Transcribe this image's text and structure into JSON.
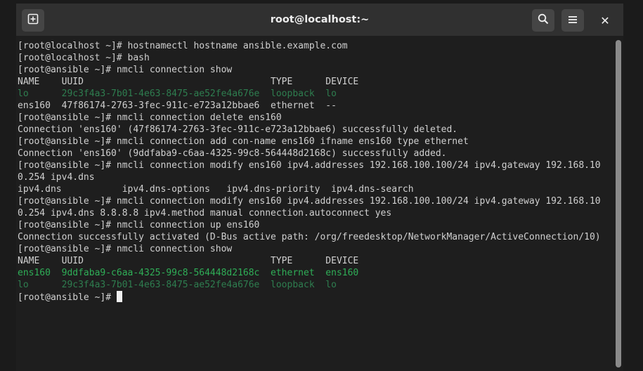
{
  "window": {
    "title": "root@localhost:~",
    "new_tab_icon": "new-tab-icon",
    "search_icon": "search-icon",
    "menu_icon": "hamburger-menu-icon",
    "close_label": "✕"
  },
  "colors": {
    "background": "#1e1e1e",
    "text": "#d0d0d0",
    "loopback_dim_green": "#2e7d4f",
    "active_green": "#2fae57"
  },
  "terminal": {
    "lines": [
      {
        "text": "[root@localhost ~]# hostnamectl hostname ansible.example.com",
        "style": "normal"
      },
      {
        "text": "[root@localhost ~]# bash",
        "style": "normal"
      },
      {
        "text": "[root@ansible ~]# nmcli connection show",
        "style": "normal"
      },
      {
        "text": "NAME    UUID                                  TYPE      DEVICE",
        "style": "normal"
      },
      {
        "text": "lo      29c3f4a3-7b01-4e63-8475-ae52fe4a676e  loopback  lo",
        "style": "dim"
      },
      {
        "text": "ens160  47f86174-2763-3fec-911c-e723a12bbae6  ethernet  --",
        "style": "normal"
      },
      {
        "text": "[root@ansible ~]# nmcli connection delete ens160",
        "style": "normal"
      },
      {
        "text": "Connection 'ens160' (47f86174-2763-3fec-911c-e723a12bbae6) successfully deleted.",
        "style": "normal"
      },
      {
        "text": "[root@ansible ~]# nmcli connection add con-name ens160 ifname ens160 type ethernet",
        "style": "normal"
      },
      {
        "text": "Connection 'ens160' (9ddfaba9-c6aa-4325-99c8-564448d2168c) successfully added.",
        "style": "normal"
      },
      {
        "text": "[root@ansible ~]# nmcli connection modify ens160 ipv4.addresses 192.168.100.100/24 ipv4.gateway 192.168.10",
        "style": "normal"
      },
      {
        "text": "0.254 ipv4.dns",
        "style": "normal"
      },
      {
        "text": "ipv4.dns           ipv4.dns-options   ipv4.dns-priority  ipv4.dns-search",
        "style": "normal"
      },
      {
        "text": "[root@ansible ~]# nmcli connection modify ens160 ipv4.addresses 192.168.100.100/24 ipv4.gateway 192.168.10",
        "style": "normal"
      },
      {
        "text": "0.254 ipv4.dns 8.8.8.8 ipv4.method manual connection.autoconnect yes",
        "style": "normal"
      },
      {
        "text": "[root@ansible ~]# nmcli connection up ens160",
        "style": "normal"
      },
      {
        "text": "Connection successfully activated (D-Bus active path: /org/freedesktop/NetworkManager/ActiveConnection/10)",
        "style": "normal"
      },
      {
        "text": "[root@ansible ~]# nmcli connection show",
        "style": "normal"
      },
      {
        "text": "NAME    UUID                                  TYPE      DEVICE",
        "style": "normal"
      },
      {
        "text": "ens160  9ddfaba9-c6aa-4325-99c8-564448d2168c  ethernet  ens160",
        "style": "bright"
      },
      {
        "text": "lo      29c3f4a3-7b01-4e63-8475-ae52fe4a676e  loopback  lo",
        "style": "dim"
      }
    ],
    "prompt": "[root@ansible ~]# "
  }
}
